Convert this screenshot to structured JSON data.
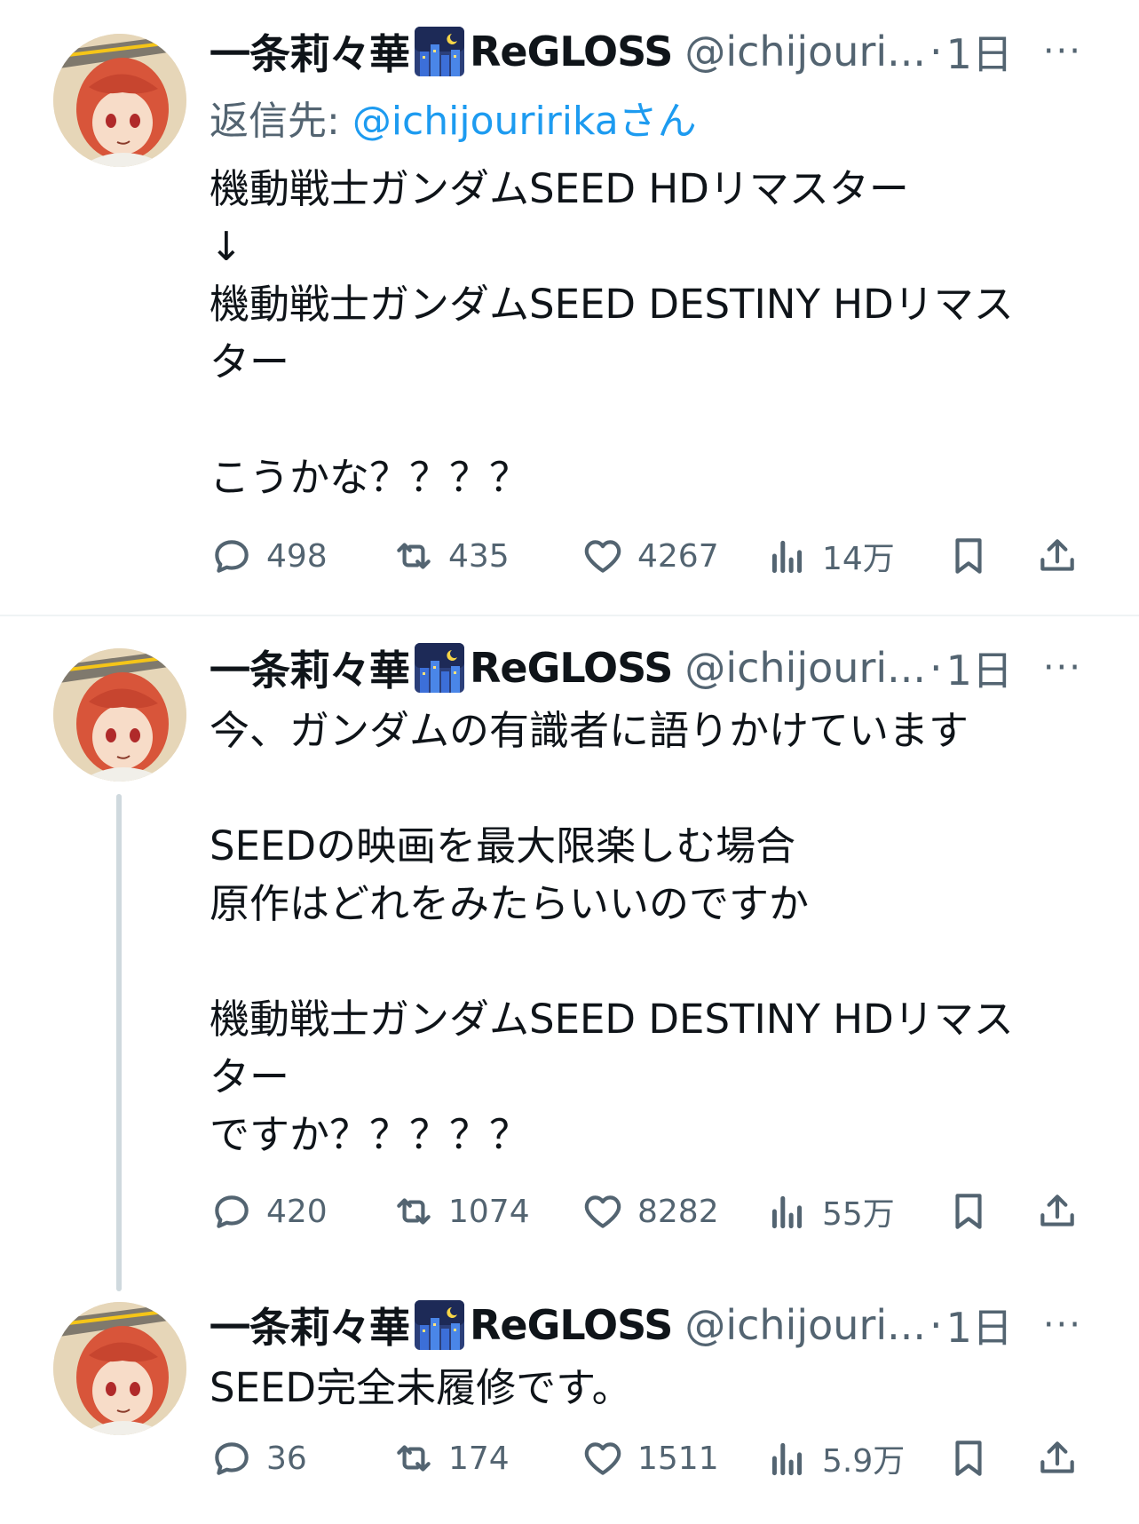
{
  "tweets": [
    {
      "name": "一条莉々華",
      "emoji_icon": "night-city-emoji",
      "name_suffix": "ReGLOSS",
      "handle": "@ichijouri...",
      "dot": "·",
      "time": "1日",
      "more": "···",
      "reply_prefix": "返信先: ",
      "reply_mention": "@ichijouririka",
      "reply_suffix": "さん",
      "text": "機動戦士ガンダムSEED HDリマスター\n↓\n機動戦士ガンダムSEED DESTINY HDリマス\nター\n\nこうかな？？？？",
      "replies": "498",
      "retweets": "435",
      "likes": "4267",
      "views": "14万"
    },
    {
      "name": "一条莉々華",
      "emoji_icon": "night-city-emoji",
      "name_suffix": "ReGLOSS",
      "handle": "@ichijouri...",
      "dot": "·",
      "time": "1日",
      "more": "···",
      "text": "今、ガンダムの有識者に語りかけています\n\nSEEDの映画を最大限楽しむ場合\n原作はどれをみたらいいのですか\n\n機動戦士ガンダムSEED DESTINY HDリマス\nター\nですか？？？？？",
      "replies": "420",
      "retweets": "1074",
      "likes": "8282",
      "views": "55万"
    },
    {
      "name": "一条莉々華",
      "emoji_icon": "night-city-emoji",
      "name_suffix": "ReGLOSS",
      "handle": "@ichijouri...",
      "dot": "·",
      "time": "1日",
      "more": "···",
      "text": "SEED完全未履修です。",
      "replies": "36",
      "retweets": "174",
      "likes": "1511",
      "views": "5.9万"
    }
  ],
  "colors": {
    "secondary_text": "#536471",
    "link": "#1d9bf0",
    "thread_line": "#cfd9de",
    "divider": "#eff3f4"
  }
}
